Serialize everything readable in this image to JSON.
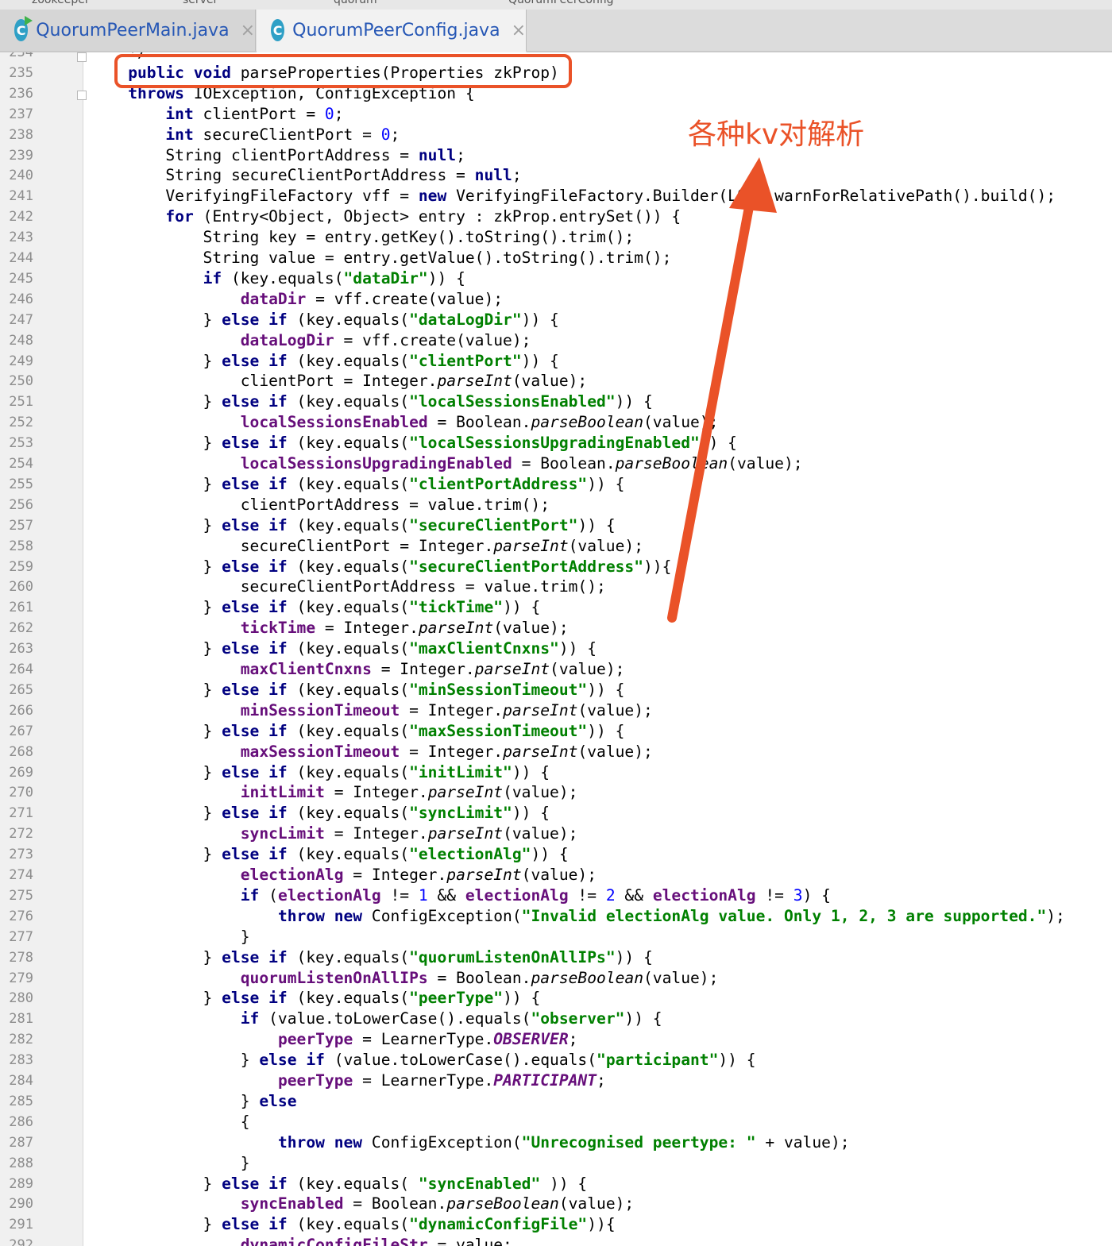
{
  "breadcrumb": [
    "zookeeper",
    "server",
    "quorum",
    "QuorumPeerConfig"
  ],
  "tabs": [
    {
      "label": "QuorumPeerMain.java",
      "icon_letter": "C",
      "close": "×",
      "active": false
    },
    {
      "label": "QuorumPeerConfig.java",
      "icon_letter": "C",
      "close": "×",
      "active": true
    }
  ],
  "annotation": {
    "text": "各种kv对解析"
  },
  "colors": {
    "annotation": "#ea5228",
    "keyword": "#000080",
    "string": "#008000",
    "field": "#660e7a",
    "number": "#0000ff"
  },
  "code_lines": [
    {
      "n": "234",
      "code": "    */"
    },
    {
      "n": "235",
      "code": "    public void parseProperties(Properties zkProp)"
    },
    {
      "n": "236",
      "code": "    throws IOException, ConfigException {"
    },
    {
      "n": "237",
      "code": "        int clientPort = 0;"
    },
    {
      "n": "238",
      "code": "        int secureClientPort = 0;"
    },
    {
      "n": "239",
      "code": "        String clientPortAddress = null;"
    },
    {
      "n": "240",
      "code": "        String secureClientPortAddress = null;"
    },
    {
      "n": "241",
      "code": "        VerifyingFileFactory vff = new VerifyingFileFactory.Builder(LOG).warnForRelativePath().build();"
    },
    {
      "n": "242",
      "code": "        for (Entry<Object, Object> entry : zkProp.entrySet()) {"
    },
    {
      "n": "243",
      "code": "            String key = entry.getKey().toString().trim();"
    },
    {
      "n": "244",
      "code": "            String value = entry.getValue().toString().trim();"
    },
    {
      "n": "245",
      "code": "            if (key.equals(\"dataDir\")) {"
    },
    {
      "n": "246",
      "code": "                dataDir = vff.create(value);"
    },
    {
      "n": "247",
      "code": "            } else if (key.equals(\"dataLogDir\")) {"
    },
    {
      "n": "248",
      "code": "                dataLogDir = vff.create(value);"
    },
    {
      "n": "249",
      "code": "            } else if (key.equals(\"clientPort\")) {"
    },
    {
      "n": "250",
      "code": "                clientPort = Integer.parseInt(value);"
    },
    {
      "n": "251",
      "code": "            } else if (key.equals(\"localSessionsEnabled\")) {"
    },
    {
      "n": "252",
      "code": "                localSessionsEnabled = Boolean.parseBoolean(value);"
    },
    {
      "n": "253",
      "code": "            } else if (key.equals(\"localSessionsUpgradingEnabled\")) {"
    },
    {
      "n": "254",
      "code": "                localSessionsUpgradingEnabled = Boolean.parseBoolean(value);"
    },
    {
      "n": "255",
      "code": "            } else if (key.equals(\"clientPortAddress\")) {"
    },
    {
      "n": "256",
      "code": "                clientPortAddress = value.trim();"
    },
    {
      "n": "257",
      "code": "            } else if (key.equals(\"secureClientPort\")) {"
    },
    {
      "n": "258",
      "code": "                secureClientPort = Integer.parseInt(value);"
    },
    {
      "n": "259",
      "code": "            } else if (key.equals(\"secureClientPortAddress\")){"
    },
    {
      "n": "260",
      "code": "                secureClientPortAddress = value.trim();"
    },
    {
      "n": "261",
      "code": "            } else if (key.equals(\"tickTime\")) {"
    },
    {
      "n": "262",
      "code": "                tickTime = Integer.parseInt(value);"
    },
    {
      "n": "263",
      "code": "            } else if (key.equals(\"maxClientCnxns\")) {"
    },
    {
      "n": "264",
      "code": "                maxClientCnxns = Integer.parseInt(value);"
    },
    {
      "n": "265",
      "code": "            } else if (key.equals(\"minSessionTimeout\")) {"
    },
    {
      "n": "266",
      "code": "                minSessionTimeout = Integer.parseInt(value);"
    },
    {
      "n": "267",
      "code": "            } else if (key.equals(\"maxSessionTimeout\")) {"
    },
    {
      "n": "268",
      "code": "                maxSessionTimeout = Integer.parseInt(value);"
    },
    {
      "n": "269",
      "code": "            } else if (key.equals(\"initLimit\")) {"
    },
    {
      "n": "270",
      "code": "                initLimit = Integer.parseInt(value);"
    },
    {
      "n": "271",
      "code": "            } else if (key.equals(\"syncLimit\")) {"
    },
    {
      "n": "272",
      "code": "                syncLimit = Integer.parseInt(value);"
    },
    {
      "n": "273",
      "code": "            } else if (key.equals(\"electionAlg\")) {"
    },
    {
      "n": "274",
      "code": "                electionAlg = Integer.parseInt(value);"
    },
    {
      "n": "275",
      "code": "                if (electionAlg != 1 && electionAlg != 2 && electionAlg != 3) {"
    },
    {
      "n": "276",
      "code": "                    throw new ConfigException(\"Invalid electionAlg value. Only 1, 2, 3 are supported.\");"
    },
    {
      "n": "277",
      "code": "                }"
    },
    {
      "n": "278",
      "code": "            } else if (key.equals(\"quorumListenOnAllIPs\")) {"
    },
    {
      "n": "279",
      "code": "                quorumListenOnAllIPs = Boolean.parseBoolean(value);"
    },
    {
      "n": "280",
      "code": "            } else if (key.equals(\"peerType\")) {"
    },
    {
      "n": "281",
      "code": "                if (value.toLowerCase().equals(\"observer\")) {"
    },
    {
      "n": "282",
      "code": "                    peerType = LearnerType.OBSERVER;"
    },
    {
      "n": "283",
      "code": "                } else if (value.toLowerCase().equals(\"participant\")) {"
    },
    {
      "n": "284",
      "code": "                    peerType = LearnerType.PARTICIPANT;"
    },
    {
      "n": "285",
      "code": "                } else"
    },
    {
      "n": "286",
      "code": "                {"
    },
    {
      "n": "287",
      "code": "                    throw new ConfigException(\"Unrecognised peertype: \" + value);"
    },
    {
      "n": "288",
      "code": "                }"
    },
    {
      "n": "289",
      "code": "            } else if (key.equals( \"syncEnabled\" )) {"
    },
    {
      "n": "290",
      "code": "                syncEnabled = Boolean.parseBoolean(value);"
    },
    {
      "n": "291",
      "code": "            } else if (key.equals(\"dynamicConfigFile\")){"
    },
    {
      "n": "292",
      "code": "                dynamicConfigFileStr = value;"
    }
  ]
}
